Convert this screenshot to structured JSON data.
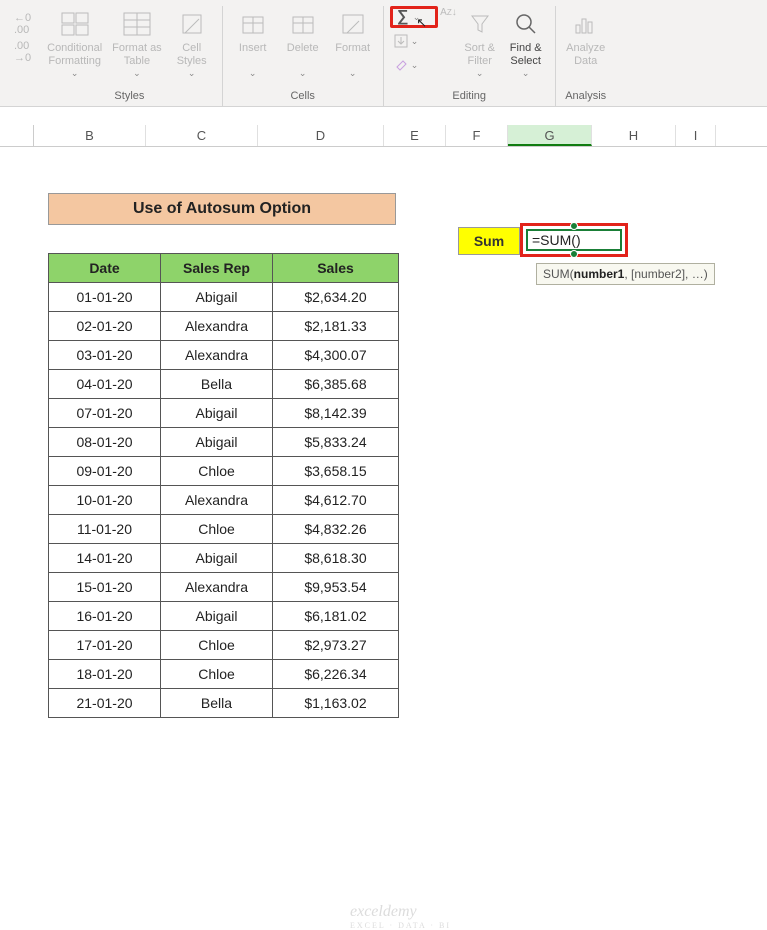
{
  "ribbon": {
    "groups": {
      "styles": {
        "label": "Styles",
        "cond_fmt": "Conditional\nFormatting",
        "fmt_table": "Format as\nTable",
        "cell_styles": "Cell\nStyles"
      },
      "cells": {
        "label": "Cells",
        "insert": "Insert",
        "delete": "Delete",
        "format": "Format"
      },
      "editing": {
        "label": "Editing",
        "sort": "Sort &\nFilter",
        "find": "Find &\nSelect",
        "az": "A",
        "za": "Z"
      },
      "analysis": {
        "label": "Analysis",
        "analyze": "Analyze\nData"
      }
    }
  },
  "chart_data": {
    "type": "table",
    "title": "Use of Autosum Option",
    "columns": [
      "Date",
      "Sales Rep",
      "Sales"
    ],
    "rows": [
      [
        "01-01-20",
        "Abigail",
        "$2,634.20"
      ],
      [
        "02-01-20",
        "Alexandra",
        "$2,181.33"
      ],
      [
        "03-01-20",
        "Alexandra",
        "$4,300.07"
      ],
      [
        "04-01-20",
        "Bella",
        "$6,385.68"
      ],
      [
        "07-01-20",
        "Abigail",
        "$8,142.39"
      ],
      [
        "08-01-20",
        "Abigail",
        "$5,833.24"
      ],
      [
        "09-01-20",
        "Chloe",
        "$3,658.15"
      ],
      [
        "10-01-20",
        "Alexandra",
        "$4,612.70"
      ],
      [
        "11-01-20",
        "Chloe",
        "$4,832.26"
      ],
      [
        "14-01-20",
        "Abigail",
        "$8,618.30"
      ],
      [
        "15-01-20",
        "Alexandra",
        "$9,953.54"
      ],
      [
        "16-01-20",
        "Abigail",
        "$6,181.02"
      ],
      [
        "17-01-20",
        "Chloe",
        "$2,973.27"
      ],
      [
        "18-01-20",
        "Chloe",
        "$6,226.34"
      ],
      [
        "21-01-20",
        "Bella",
        "$1,163.02"
      ]
    ]
  },
  "columns": [
    "B",
    "C",
    "D",
    "E",
    "F",
    "G",
    "H",
    "I"
  ],
  "sum_label": "Sum",
  "formula": "=SUM()",
  "tooltip_pre": "SUM(",
  "tooltip_bold": "number1",
  "tooltip_post": ", [number2], …)",
  "watermark": "exceldemy",
  "watermark_sub": "EXCEL · DATA · BI"
}
